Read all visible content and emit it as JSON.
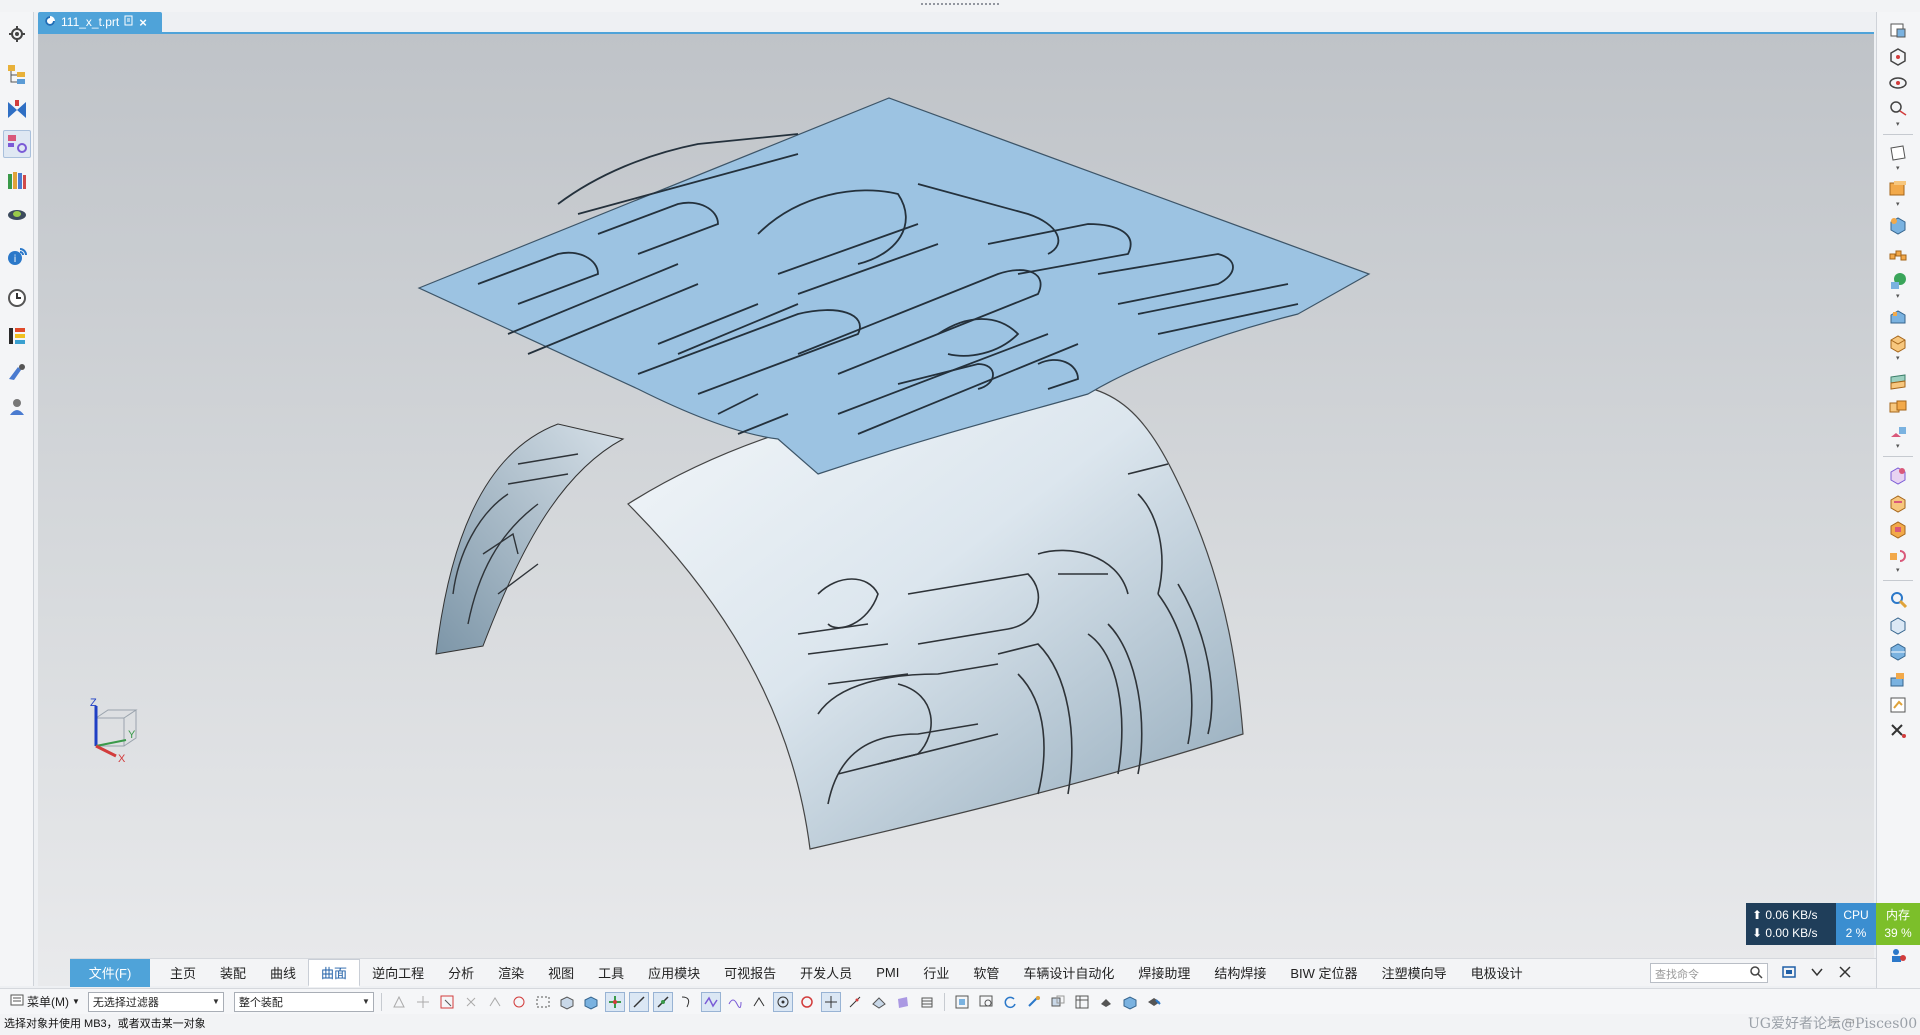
{
  "document": {
    "tab_title": "111_x_t.prt"
  },
  "ribbon": {
    "file_tab": "文件(F)",
    "tabs": [
      "主页",
      "装配",
      "曲线",
      "曲面",
      "逆向工程",
      "分析",
      "渲染",
      "视图",
      "工具",
      "应用模块",
      "可视报告",
      "开发人员",
      "PMI",
      "行业",
      "软管",
      "车辆设计自动化",
      "焊接助理",
      "结构焊接",
      "BIW 定位器",
      "注塑模向导",
      "电极设计"
    ],
    "active_tab": "曲面",
    "search_placeholder": "查找命令"
  },
  "toolbar": {
    "menu_label": "菜单(M)",
    "filter_value": "无选择过滤器",
    "assembly_value": "整个装配"
  },
  "status": {
    "text": "选择对象并使用 MB3，或者双击某一对象",
    "watermark": "UG爱好者论坛@Pisces00"
  },
  "net_monitor": {
    "up": "0.06 KB/s",
    "down": "0.00 KB/s",
    "cpu_label": "CPU",
    "cpu_value": "2 %",
    "mem_label": "内存",
    "mem_value": "39 %"
  },
  "triad": {
    "z": "Z",
    "y": "Y",
    "x": "X"
  },
  "colors": {
    "accent": "#4fa3d9",
    "sheet": "#9cc3e2",
    "surface": "#bfd3e0",
    "cpu": "#3b8ed0",
    "mem": "#7cbf2a"
  }
}
